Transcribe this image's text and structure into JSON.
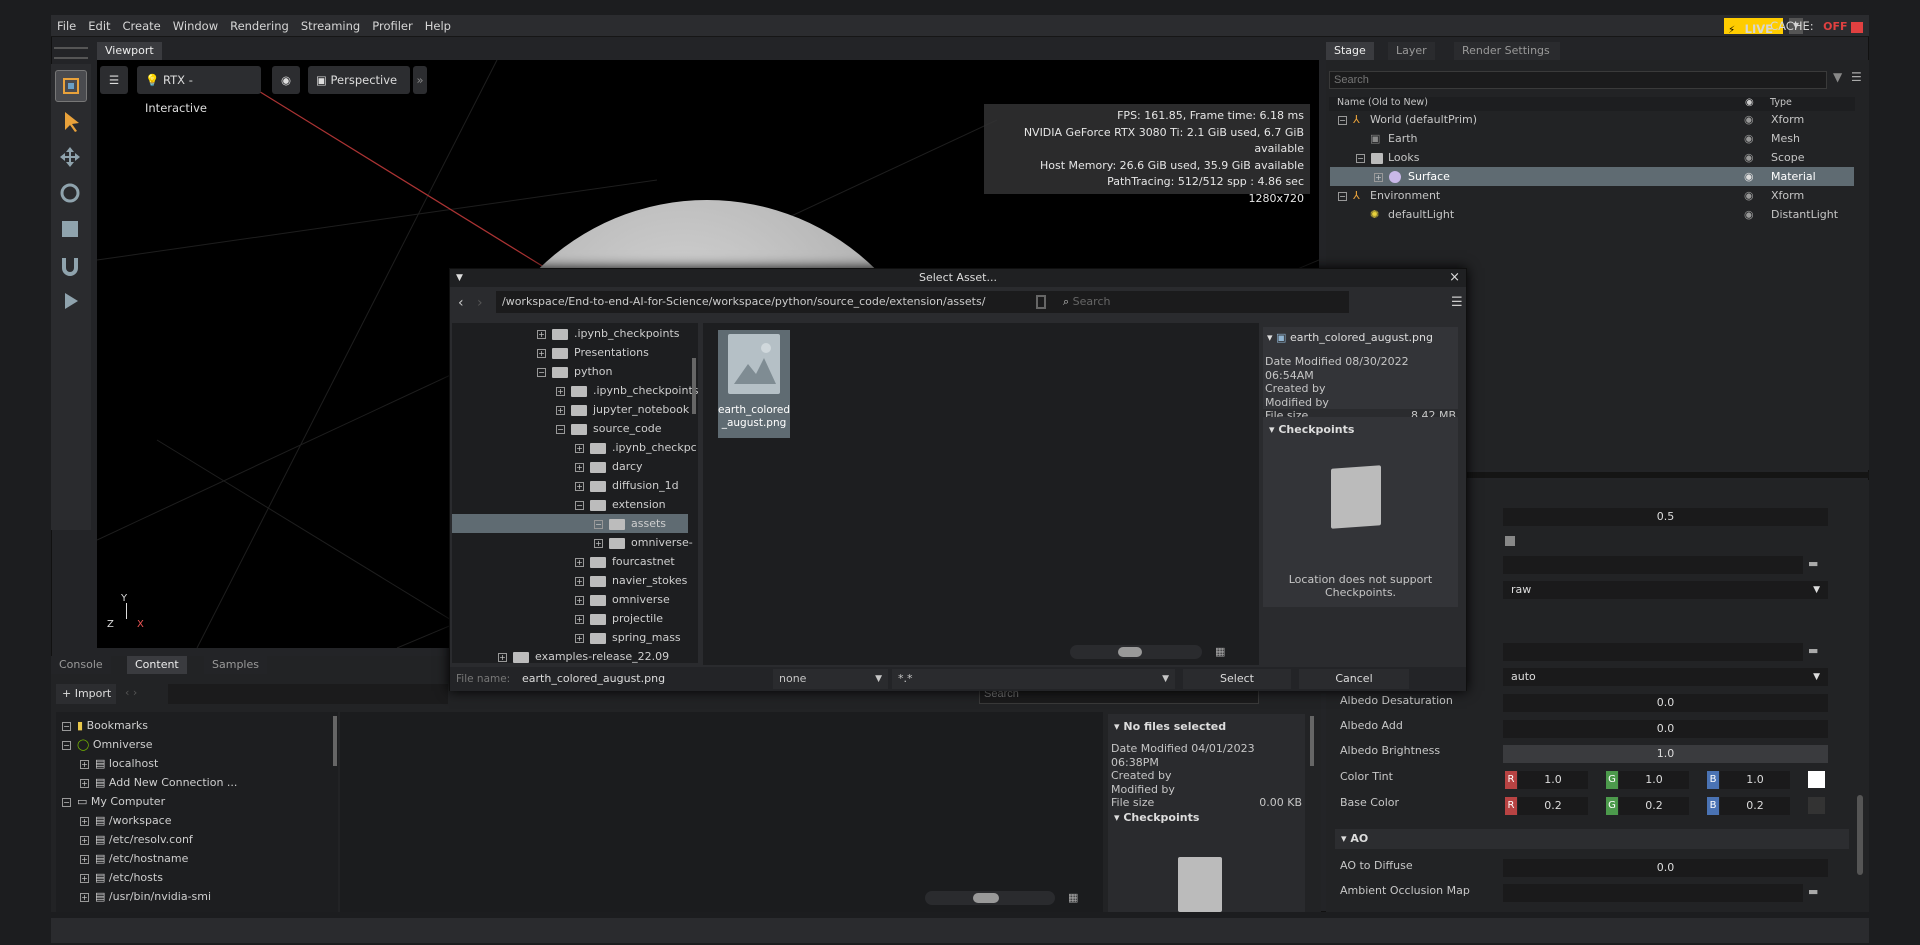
{
  "menubar": {
    "items": [
      "File",
      "Edit",
      "Create",
      "Window",
      "Rendering",
      "Streaming",
      "Profiler",
      "Help"
    ],
    "live": "LIVE",
    "cache_label": "CACHE:",
    "cache_state": "OFF"
  },
  "viewport": {
    "tab": "Viewport",
    "render_mode": "RTX - Interactive",
    "camera": "Perspective",
    "stats": [
      "FPS: 161.85, Frame time: 6.18 ms",
      "NVIDIA GeForce RTX 3080 Ti: 2.1 GiB used, 6.7 GiB available",
      "Host Memory: 26.6 GiB used, 35.9 GiB available",
      "PathTracing: 512/512 spp : 4.86 sec",
      "1280x720"
    ],
    "axis": {
      "y": "Y",
      "z": "Z",
      "x": "X"
    }
  },
  "stage": {
    "tabs": [
      "Stage",
      "Layer",
      "Render Settings"
    ],
    "search_placeholder": "Search",
    "col_name": "Name (Old to New)",
    "col_type": "Type",
    "rows": [
      {
        "name": "World (defaultPrim)",
        "type": "Xform"
      },
      {
        "name": "Earth",
        "type": "Mesh"
      },
      {
        "name": "Looks",
        "type": "Scope"
      },
      {
        "name": "Surface",
        "type": "Material"
      },
      {
        "name": "Environment",
        "type": "Xform"
      },
      {
        "name": "defaultLight",
        "type": "DistantLight"
      }
    ]
  },
  "properties": {
    "top_value": "0.5",
    "color_space_1": "raw",
    "color_space_2": "auto",
    "albedo_desat_label": "Albedo Desaturation",
    "albedo_desat": "0.0",
    "albedo_add_label": "Albedo Add",
    "albedo_add": "0.0",
    "albedo_bright_label": "Albedo Brightness",
    "albedo_bright": "1.0",
    "color_tint_label": "Color Tint",
    "tint": {
      "r": "1.0",
      "g": "1.0",
      "b": "1.0"
    },
    "base_color_label": "Base Color",
    "base": {
      "r": "0.2",
      "g": "0.2",
      "b": "0.2"
    },
    "rgb": {
      "r": "R",
      "g": "G",
      "b": "B"
    },
    "ao_section": "AO",
    "ao_diffuse_label": "AO to Diffuse",
    "ao_diffuse": "0.0",
    "ao_map_label": "Ambient Occlusion Map"
  },
  "dialog": {
    "title": "Select Asset...",
    "path": "/workspace/End-to-end-AI-for-Science/workspace/python/source_code/extension/assets/",
    "search_placeholder": "Search",
    "tree": [
      ".ipynb_checkpoints",
      "Presentations",
      "python",
      ".ipynb_checkpoints",
      "jupyter_notebook",
      "source_code",
      ".ipynb_checkpc",
      "darcy",
      "diffusion_1d",
      "extension",
      "assets",
      "omniverse-",
      "fourcastnet",
      "navier_stokes",
      "omniverse",
      "projectile",
      "spring_mass",
      "examples-release_22.09"
    ],
    "file_label": "earth_colored\n_august.png",
    "file_line1": "earth_colored",
    "file_line2": "_august.png",
    "info": {
      "name": "earth_colored_august.png",
      "date": "Date Modified 08/30/2022 06:54AM",
      "created": "Created by",
      "modified": "Modified by",
      "size_label": "File size",
      "size": "8.42 MB",
      "checkpoints": "Checkpoints",
      "note": "Location does not support Checkpoints."
    },
    "filename_label": "File name:",
    "filename": "earth_colored_august.png",
    "filter1": "none",
    "filter2": "*.*",
    "select": "Select",
    "cancel": "Cancel"
  },
  "content": {
    "tabs": [
      "Console",
      "Content",
      "Samples"
    ],
    "import": "Import",
    "search_placeholder": "Search",
    "tree": [
      "Bookmarks",
      "Omniverse",
      "localhost",
      "Add New Connection ...",
      "My Computer",
      "/workspace",
      "/etc/resolv.conf",
      "/etc/hostname",
      "/etc/hosts",
      "/usr/bin/nvidia-smi"
    ],
    "info": {
      "title": "No files selected",
      "date": "Date Modified 04/01/2023 06:38PM",
      "created": "Created by",
      "modified": "Modified by",
      "size_label": "File size",
      "size": "0.00 KB",
      "checkpoints": "Checkpoints"
    }
  }
}
